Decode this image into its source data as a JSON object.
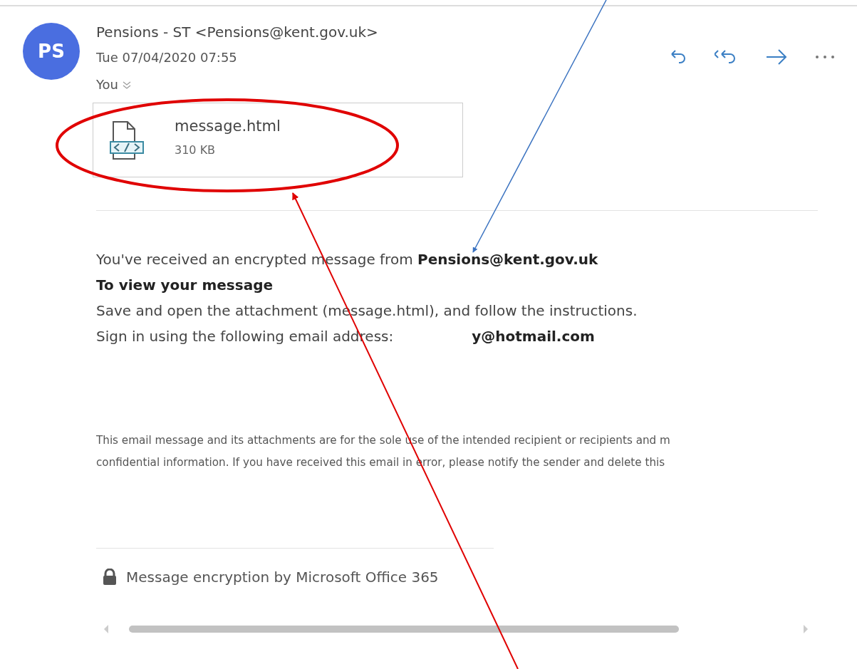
{
  "sender": {
    "initials": "PS",
    "from": "Pensions - ST <Pensions@kent.gov.uk>",
    "date": "Tue 07/04/2020 07:55",
    "to": "You"
  },
  "actions": [
    {
      "kind": "reply"
    },
    {
      "kind": "reply_all"
    },
    {
      "kind": "forward"
    },
    {
      "kind": "more"
    }
  ],
  "attachment": {
    "name": "message.html",
    "size": "310 KB"
  },
  "body": [
    {
      "kind": "paragraph",
      "text": "You've received an encrypted message from **Pensions@kent.gov.uk**"
    },
    {
      "kind": "heading",
      "text": "To view your message"
    },
    {
      "kind": "paragraph",
      "text": "Save and open the attachment (message.html), and follow the instructions."
    },
    {
      "kind": "address",
      "text": "Sign in using the following email address:",
      "address_end": "y@hotmail.com"
    }
  ],
  "disclaimer": [
    "This email message and its attachments are for the sole use of the intended recipient or recipients and m",
    "confidential information. If you have received this email in error, please notify the sender and delete this"
  ],
  "footer": "Message encryption by Microsoft Office 365"
}
